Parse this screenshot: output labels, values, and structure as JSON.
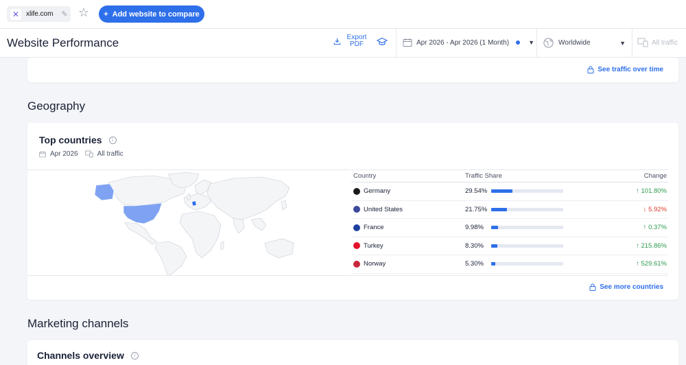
{
  "topbar": {
    "site_name": "xlife.com",
    "add_button_label": "Add website to compare"
  },
  "header": {
    "title": "Website Performance",
    "export_label": "Export PDF",
    "date_range": "Apr 2026 - Apr 2026 (1 Month)",
    "region": "Worldwide",
    "traffic_filter": "All traffic"
  },
  "traffic_card": {
    "link_label": "See traffic over time"
  },
  "geography": {
    "section_title": "Geography",
    "card_title": "Top countries",
    "period": "Apr 2026",
    "traffic": "All traffic",
    "columns": {
      "country": "Country",
      "share": "Traffic Share",
      "change": "Change"
    },
    "rows": [
      {
        "country": "Germany",
        "share": "29.54%",
        "share_value": 29.54,
        "change": "101.80%",
        "direction": "up",
        "flag_color": "#1a1a1a"
      },
      {
        "country": "United States",
        "share": "21.75%",
        "share_value": 21.75,
        "change": "5.92%",
        "direction": "down",
        "flag_color": "#3b4a9b"
      },
      {
        "country": "France",
        "share": "9.98%",
        "share_value": 9.98,
        "change": "0.37%",
        "direction": "up",
        "flag_color": "#1f3fa0"
      },
      {
        "country": "Turkey",
        "share": "8.30%",
        "share_value": 8.3,
        "change": "215.86%",
        "direction": "up",
        "flag_color": "#e3142a"
      },
      {
        "country": "Norway",
        "share": "5.30%",
        "share_value": 5.3,
        "change": "529.61%",
        "direction": "up",
        "flag_color": "#c8283a"
      }
    ],
    "link_label": "See more countries"
  },
  "marketing": {
    "section_title": "Marketing channels",
    "card_title": "Channels overview"
  },
  "colors": {
    "accent": "#2e6fea",
    "up": "#2d9a4d",
    "down": "#e0392b"
  }
}
